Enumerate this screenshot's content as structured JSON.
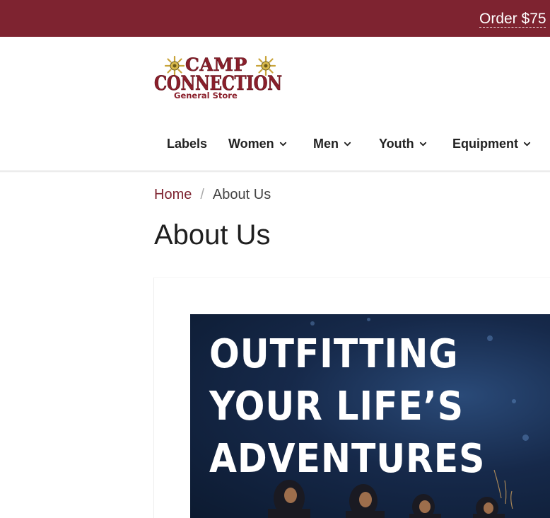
{
  "topbar": {
    "promo_text": "Order $75",
    "background": "#7e2330"
  },
  "logo": {
    "line1": "CAMP",
    "line2": "CONNECTION",
    "line3": "General Store",
    "brand_color": "#8a1f2b"
  },
  "nav": {
    "items": [
      {
        "label": "Labels",
        "has_dropdown": false
      },
      {
        "label": "Women",
        "has_dropdown": true
      },
      {
        "label": "Men",
        "has_dropdown": true
      },
      {
        "label": "Youth",
        "has_dropdown": true
      },
      {
        "label": "Equipment",
        "has_dropdown": true
      }
    ]
  },
  "breadcrumb": {
    "home": "Home",
    "separator": "/",
    "current": "About Us"
  },
  "page": {
    "title": "About Us"
  },
  "hero": {
    "line1": "OUTFITTING",
    "line2": "YOUR LIFE’S",
    "line3": "ADVENTURES"
  },
  "icons": [
    "sun-icon",
    "chevron-down-icon"
  ]
}
